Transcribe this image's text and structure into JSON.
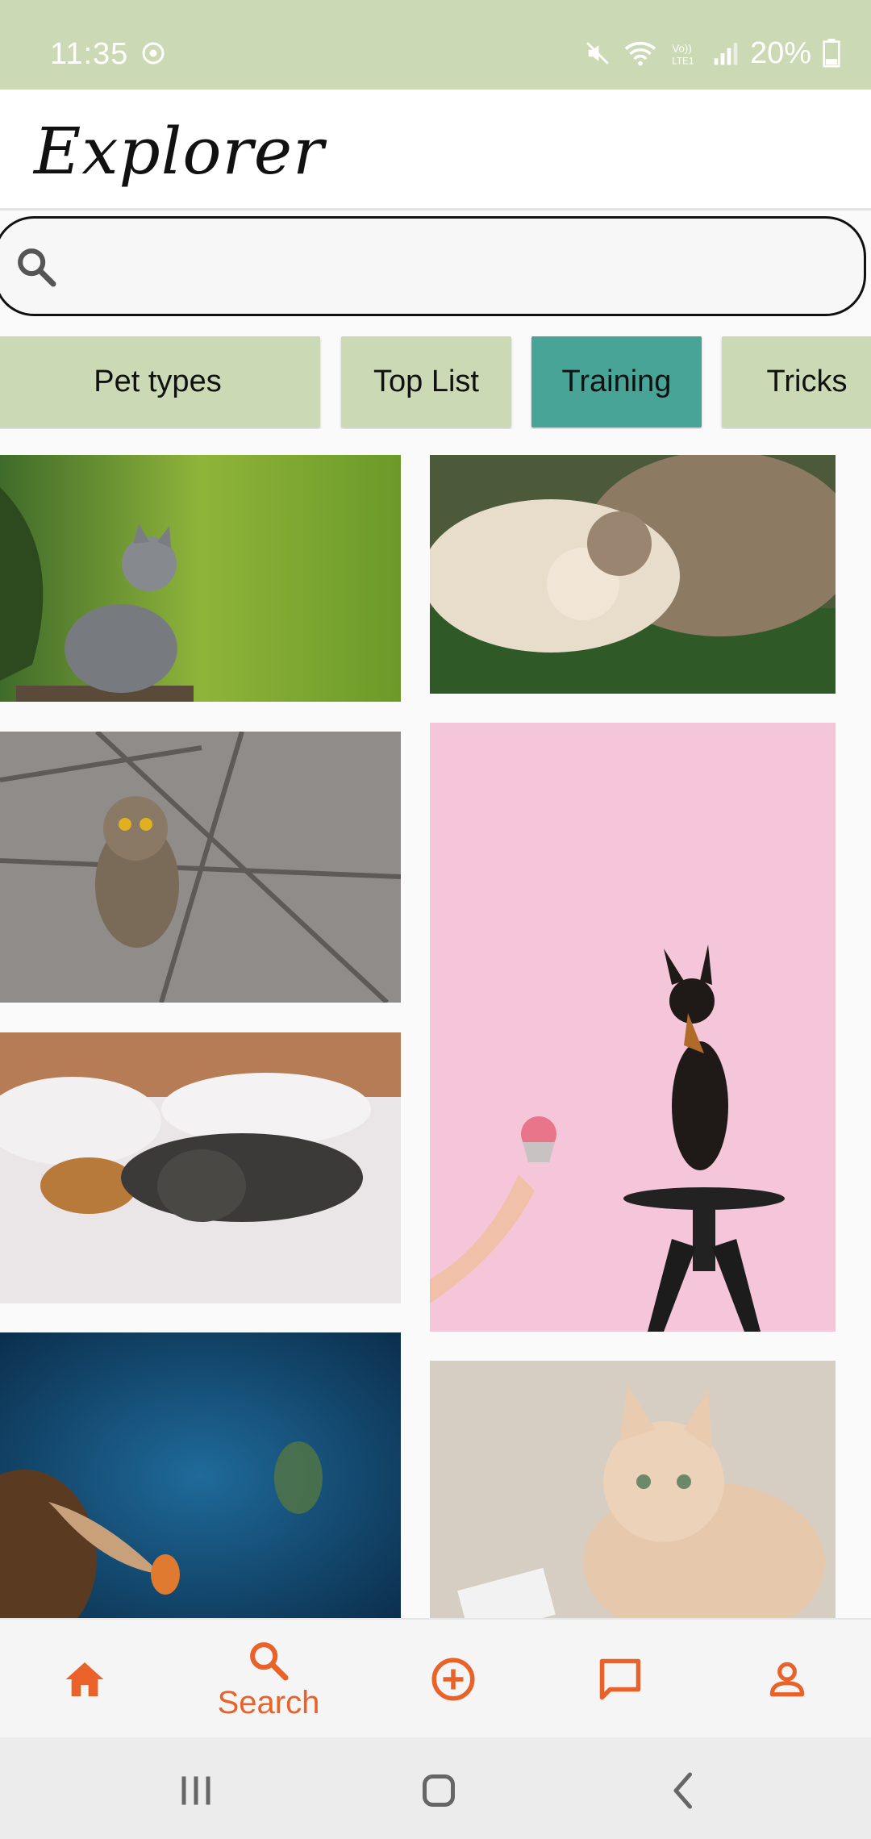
{
  "status_bar": {
    "time": "11:35",
    "battery": "20%"
  },
  "app": {
    "title": "Explorer"
  },
  "search": {
    "placeholder": "",
    "value": ""
  },
  "chips": [
    {
      "label": "Pet types",
      "active": false
    },
    {
      "label": "Top List",
      "active": false
    },
    {
      "label": "Training",
      "active": true
    },
    {
      "label": "Tricks",
      "active": false
    }
  ],
  "photos": [
    {
      "icon": "kitten-on-log-photo"
    },
    {
      "icon": "cat-and-dog-cuddling-photo"
    },
    {
      "icon": "owl-on-branch-photo"
    },
    {
      "icon": "dog-standing-on-stool-pink-photo"
    },
    {
      "icon": "dogs-sleeping-on-bed-photo"
    },
    {
      "icon": "fish-underwater-photo"
    },
    {
      "icon": "cream-cat-lying-photo"
    }
  ],
  "bottom_nav": {
    "items": [
      {
        "icon": "home-icon",
        "label": ""
      },
      {
        "icon": "search-icon",
        "label": "Search"
      },
      {
        "icon": "add-circle-icon",
        "label": ""
      },
      {
        "icon": "chat-icon",
        "label": ""
      },
      {
        "icon": "person-icon",
        "label": ""
      }
    ],
    "accent": "#e8622a"
  },
  "colors": {
    "status_bar": "#cbd9b4",
    "chip": "#cbd9b4",
    "chip_active": "#47a497"
  }
}
